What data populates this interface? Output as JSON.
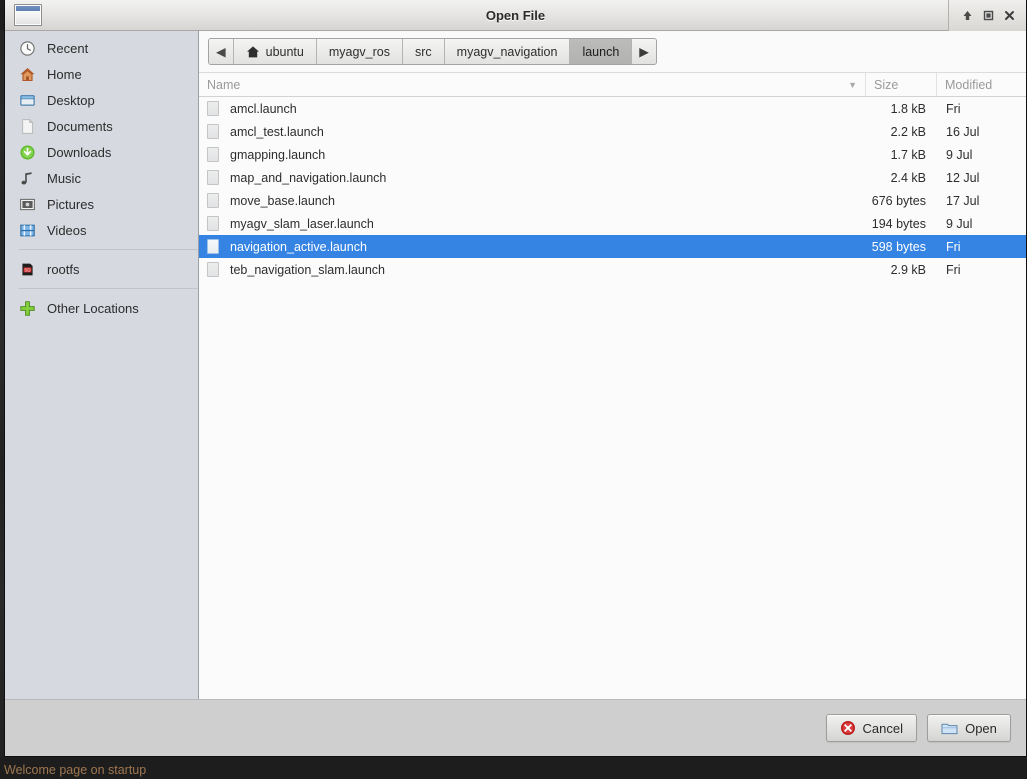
{
  "background": {
    "clipped_text": "Welcome page on startup"
  },
  "window": {
    "title": "Open File",
    "icon": "window-icon",
    "buttons": [
      {
        "name": "shade-button",
        "icon": "arrow-up-icon",
        "label": "Shade"
      },
      {
        "name": "maximize-button",
        "icon": "square-icon",
        "label": "Maximize"
      },
      {
        "name": "close-button",
        "icon": "close-x-icon",
        "label": "Close"
      }
    ]
  },
  "sidebar": {
    "groups": [
      {
        "items": [
          {
            "label": "Recent",
            "icon": "clock-icon"
          },
          {
            "label": "Home",
            "icon": "home-icon"
          },
          {
            "label": "Desktop",
            "icon": "desktop-icon"
          },
          {
            "label": "Documents",
            "icon": "document-icon"
          },
          {
            "label": "Downloads",
            "icon": "download-icon"
          },
          {
            "label": "Music",
            "icon": "music-note-icon"
          },
          {
            "label": "Pictures",
            "icon": "pictures-icon"
          },
          {
            "label": "Videos",
            "icon": "video-film-icon"
          }
        ]
      },
      {
        "items": [
          {
            "label": "rootfs",
            "icon": "sd-card-icon"
          }
        ]
      },
      {
        "items": [
          {
            "label": "Other Locations",
            "icon": "plus-green-icon"
          }
        ]
      }
    ]
  },
  "pathbar": {
    "prev_arrow": "◀",
    "next_arrow": "▶",
    "crumbs": [
      {
        "label": "ubuntu",
        "icon": "home-icon",
        "active": false
      },
      {
        "label": "myagv_ros",
        "icon": "",
        "active": false
      },
      {
        "label": "src",
        "icon": "",
        "active": false
      },
      {
        "label": "myagv_navigation",
        "icon": "",
        "active": false
      },
      {
        "label": "launch",
        "icon": "",
        "active": true
      }
    ]
  },
  "file_list": {
    "columns": {
      "name": "Name",
      "size": "Size",
      "modified": "Modified",
      "sort_indicator": "▼"
    },
    "rows": [
      {
        "name": "amcl.launch",
        "size": "1.8 kB",
        "modified": "Fri",
        "selected": false,
        "icon": "file-icon"
      },
      {
        "name": "amcl_test.launch",
        "size": "2.2 kB",
        "modified": "16 Jul",
        "selected": false,
        "icon": "file-icon"
      },
      {
        "name": "gmapping.launch",
        "size": "1.7 kB",
        "modified": "9 Jul",
        "selected": false,
        "icon": "file-icon"
      },
      {
        "name": "map_and_navigation.launch",
        "size": "2.4 kB",
        "modified": "12 Jul",
        "selected": false,
        "icon": "file-icon"
      },
      {
        "name": "move_base.launch",
        "size": "676 bytes",
        "modified": "17 Jul",
        "selected": false,
        "icon": "file-icon"
      },
      {
        "name": "myagv_slam_laser.launch",
        "size": "194 bytes",
        "modified": "9 Jul",
        "selected": false,
        "icon": "file-icon"
      },
      {
        "name": "navigation_active.launch",
        "size": "598 bytes",
        "modified": "Fri",
        "selected": true,
        "icon": "file-icon"
      },
      {
        "name": "teb_navigation_slam.launch",
        "size": "2.9 kB",
        "modified": "Fri",
        "selected": false,
        "icon": "file-icon"
      }
    ]
  },
  "actions": {
    "cancel_label": "Cancel",
    "cancel_icon": "cancel-circle-icon",
    "open_label": "Open",
    "open_icon": "folder-icon"
  },
  "colors": {
    "selection": "#3584e4",
    "sidebar_bg": "#d6dae0",
    "list_bg": "#fbfbfb",
    "actionbar_bg": "#cfcfcf",
    "cancel_red": "#cc2222",
    "plus_green": "#73c936"
  }
}
